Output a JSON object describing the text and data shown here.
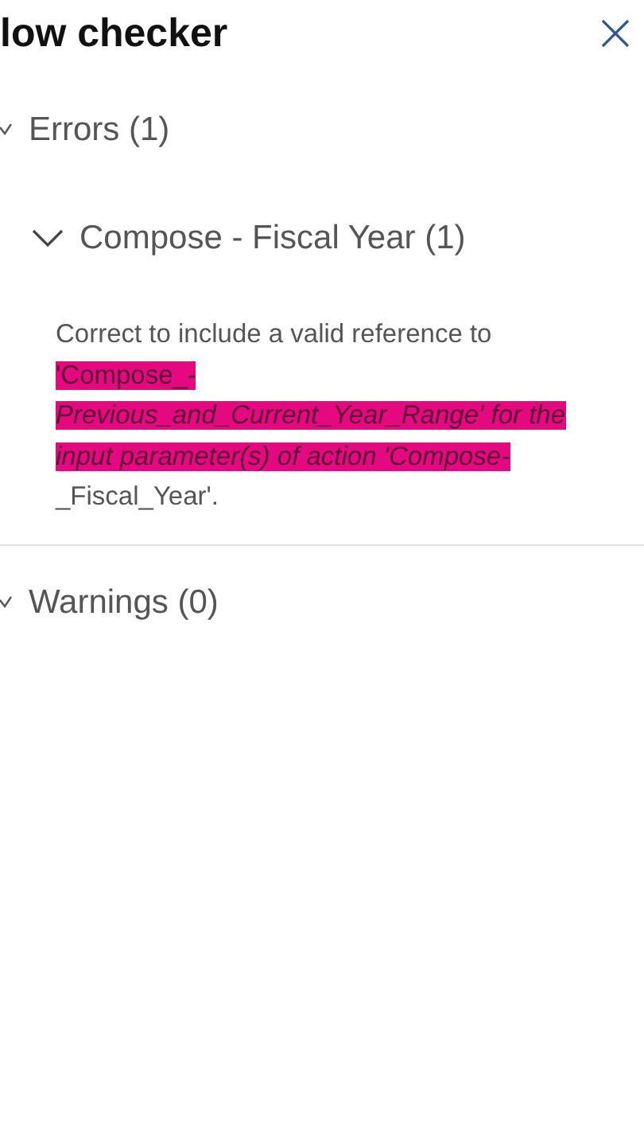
{
  "panel": {
    "title": "low checker"
  },
  "sections": [
    {
      "label": "Errors (1)",
      "expanded": true,
      "items": [
        {
          "label": "Compose - Fiscal Year (1)",
          "expanded": true,
          "message": [
            {
              "text": "Correct to include a valid reference to ",
              "highlighted": false
            },
            {
              "text": "'Compose_-*Previous_and_Current_Year_Range' for the input parameter(s) of action 'Compose-*",
              "highlighted": true
            },
            {
              "text": "_Fiscal_Year'.",
              "highlighted": false
            }
          ]
        }
      ]
    },
    {
      "label": "Warnings (0)",
      "expanded": true
    }
  ]
}
